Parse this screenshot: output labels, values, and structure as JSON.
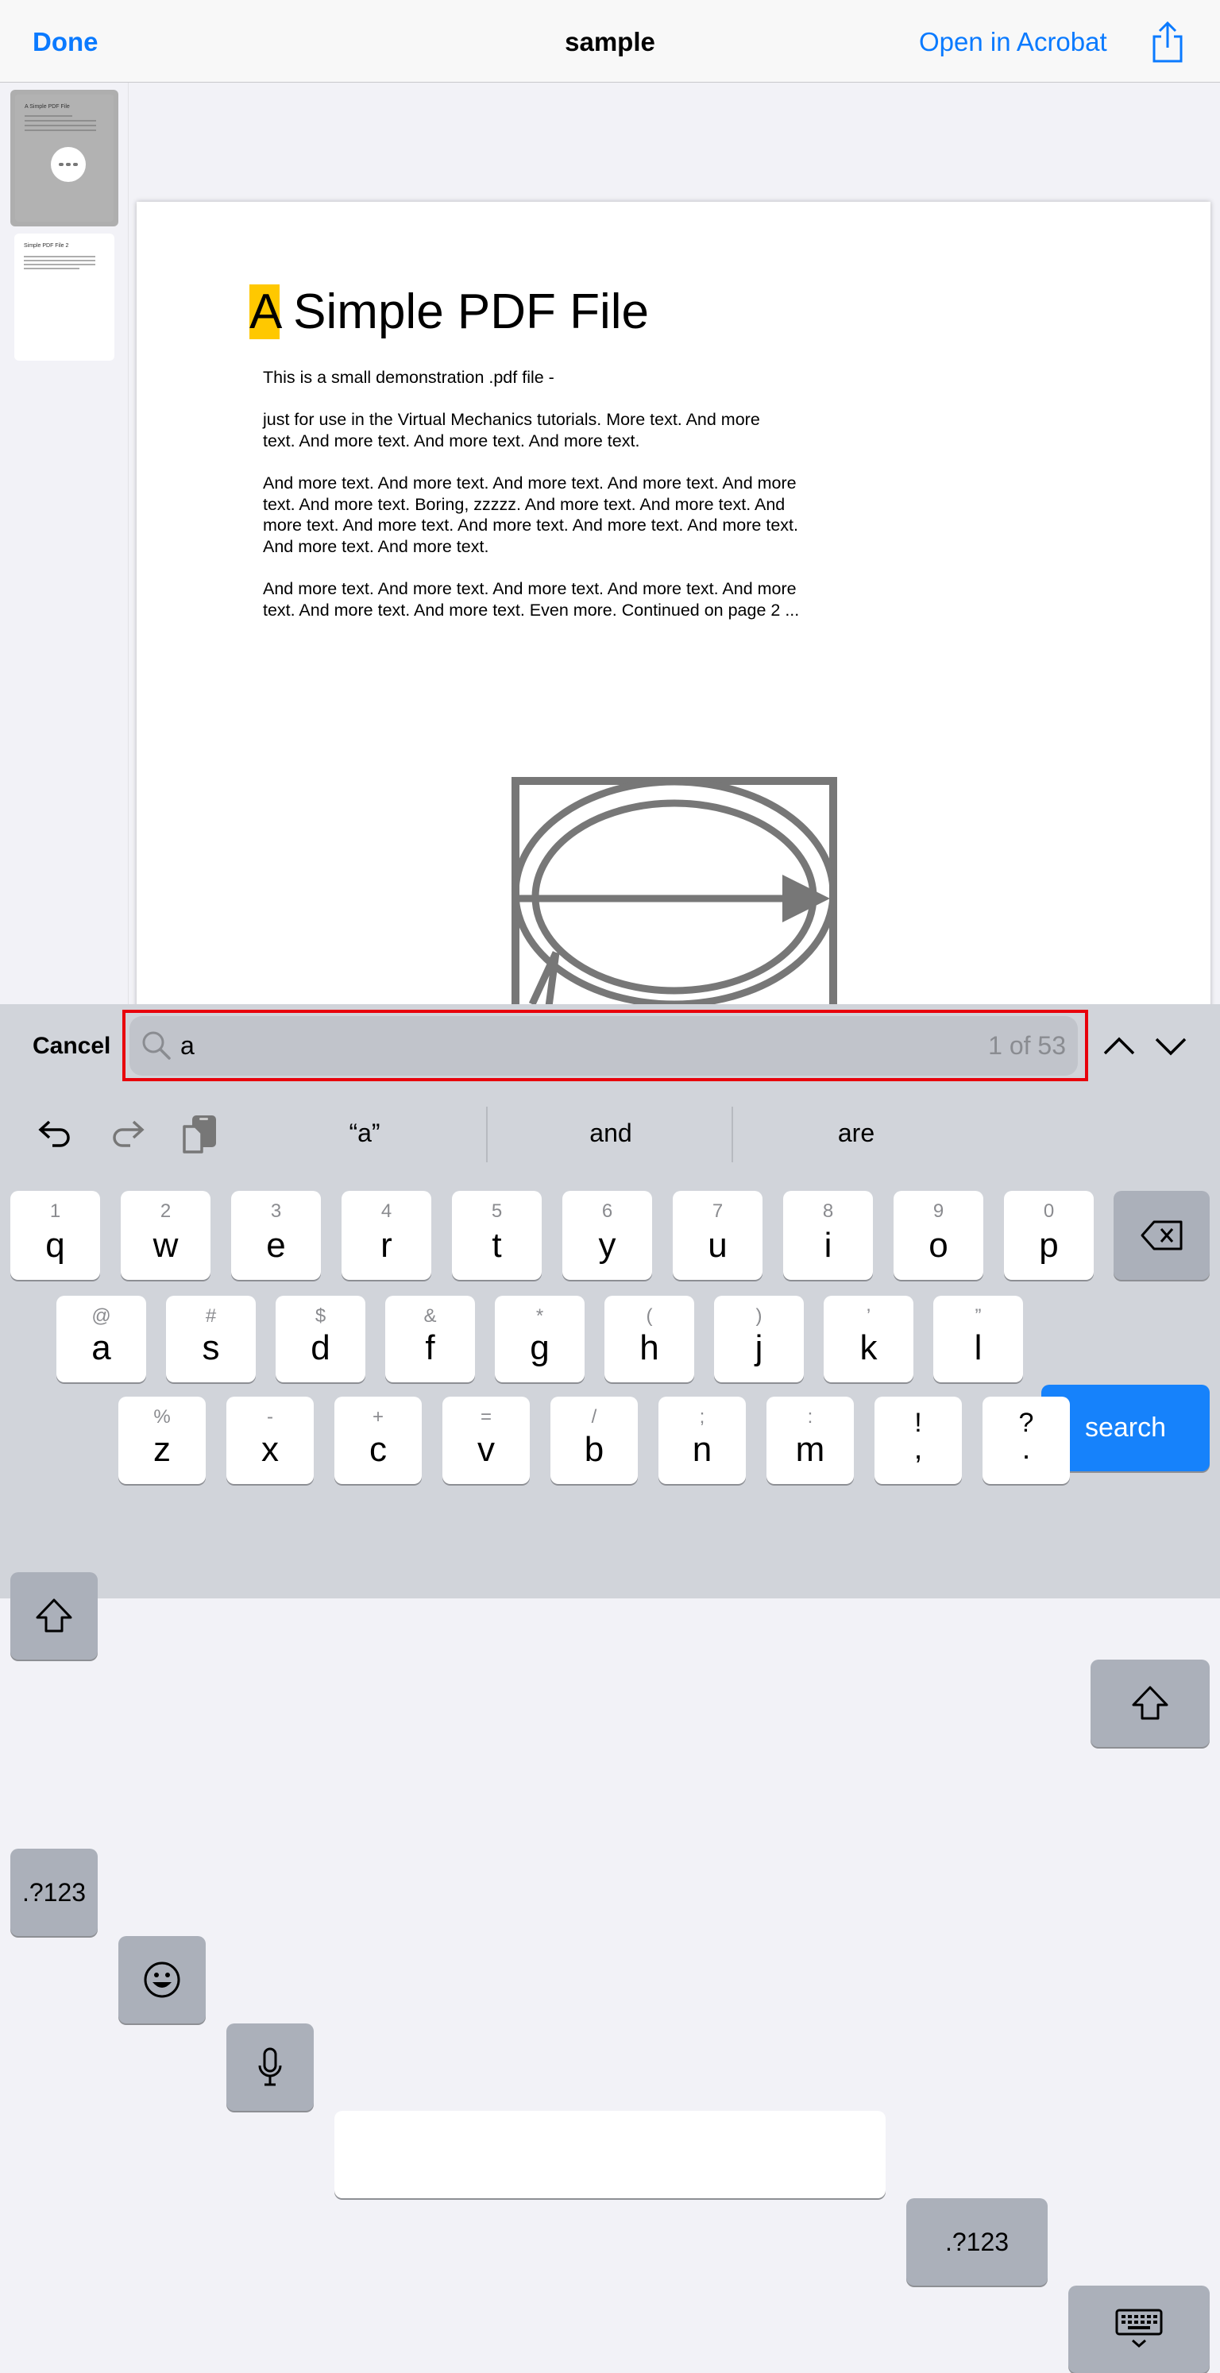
{
  "topbar": {
    "done": "Done",
    "title": "sample",
    "open_in": "Open in Acrobat"
  },
  "thumbnails": [
    {
      "title": "A Simple PDF File"
    },
    {
      "title": "Simple PDF File 2"
    }
  ],
  "document": {
    "title_highlight": "A",
    "title_rest": " Simple PDF File",
    "body": "This is a small demonstration .pdf file -\n\njust for use in the Virtual Mechanics tutorials. More text. And more\ntext. And more text. And more text. And more text.\n\nAnd more text. And more text. And more text. And more text. And more\ntext. And more text. Boring, zzzzz. And more text. And more text. And\nmore text. And more text. And more text. And more text. And more text.\nAnd more text. And more text.\n\nAnd more text. And more text. And more text. And more text. And more\ntext. And more text. And more text. Even more. Continued on page 2 ..."
  },
  "find": {
    "cancel": "Cancel",
    "query": "a",
    "count": "1 of 53"
  },
  "suggestions": [
    "“a”",
    "and",
    "are"
  ],
  "keyboard": {
    "row1": [
      [
        "1",
        "q"
      ],
      [
        "2",
        "w"
      ],
      [
        "3",
        "e"
      ],
      [
        "4",
        "r"
      ],
      [
        "5",
        "t"
      ],
      [
        "6",
        "y"
      ],
      [
        "7",
        "u"
      ],
      [
        "8",
        "i"
      ],
      [
        "9",
        "o"
      ],
      [
        "0",
        "p"
      ]
    ],
    "row2": [
      [
        "@",
        "a"
      ],
      [
        "#",
        "s"
      ],
      [
        "$",
        "d"
      ],
      [
        "&",
        "f"
      ],
      [
        "*",
        "g"
      ],
      [
        "(",
        "h"
      ],
      [
        ")",
        "j"
      ],
      [
        "’",
        "k"
      ],
      [
        "”",
        "l"
      ]
    ],
    "row3": [
      [
        "%",
        "z"
      ],
      [
        "-",
        "x"
      ],
      [
        "+",
        "c"
      ],
      [
        "=",
        "v"
      ],
      [
        "/",
        "b"
      ],
      [
        ";",
        "n"
      ],
      [
        ":",
        "m"
      ],
      [
        "!",
        ","
      ],
      [
        "?",
        "."
      ]
    ],
    "search": "search",
    "numbers": ".?123"
  },
  "colors": {
    "accent": "#0a7aff",
    "highlight": "#ffc800",
    "find_border": "#e8000b",
    "search_key": "#1682fb"
  }
}
